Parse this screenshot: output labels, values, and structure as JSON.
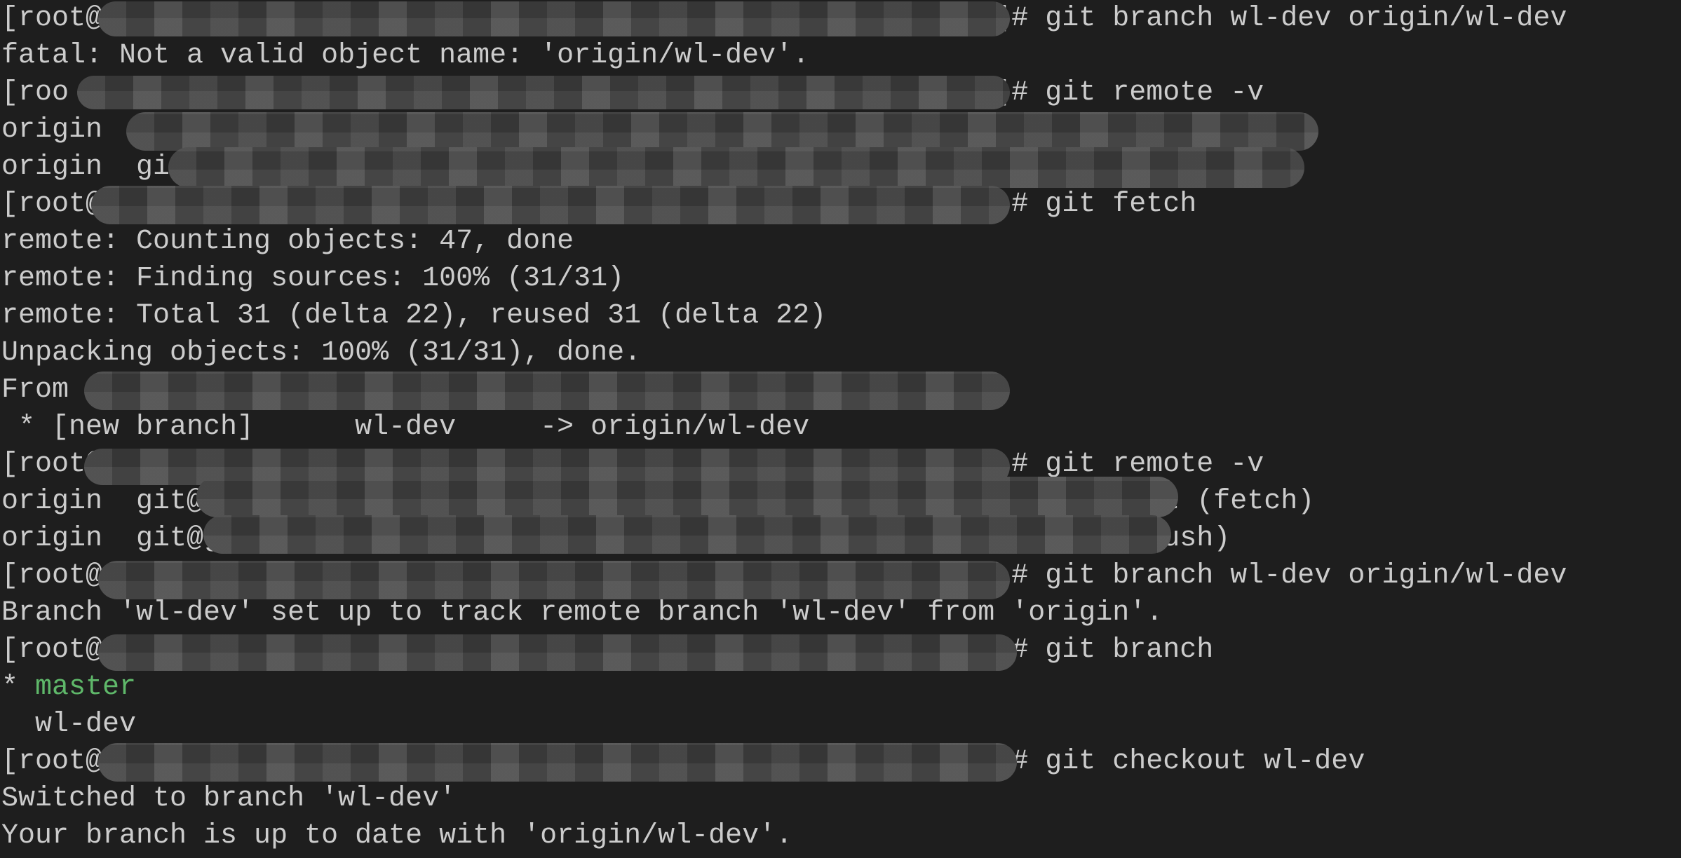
{
  "terminal": {
    "colors": {
      "background": "#1e1e1e",
      "text": "#cccccc",
      "branch_current": "#5fb86a"
    },
    "lines": [
      [
        {
          "t": "[root@                                                     ]# git branch wl-dev origin/wl-dev"
        }
      ],
      [
        {
          "t": "fatal: Not a valid object name: 'origin/wl-dev'."
        }
      ],
      [
        {
          "t": "[roo                                                       ]# git remote -v"
        }
      ],
      [
        {
          "t": "origin"
        }
      ],
      [
        {
          "t": "origin  gi"
        }
      ],
      [
        {
          "t": "[root@                                                      # git fetch"
        }
      ],
      [
        {
          "t": "remote: Counting objects: 47, done"
        }
      ],
      [
        {
          "t": "remote: Finding sources: 100% (31/31)"
        }
      ],
      [
        {
          "t": "remote: Total 31 (delta 22), reused 31 (delta 22)"
        }
      ],
      [
        {
          "t": "Unpacking objects: 100% (31/31), done."
        }
      ],
      [
        {
          "t": "From"
        }
      ],
      [
        {
          "t": " * [new branch]      wl-dev     -> origin/wl-dev"
        }
      ],
      [
        {
          "t": "[root@                                                      # git remote -v"
        }
      ],
      [
        {
          "t": "origin  git@                                                        it (fetch)"
        }
      ],
      [
        {
          "t": "origin  git@gi                                                     (push)"
        }
      ],
      [
        {
          "t": "[root@                                                      # git branch wl-dev origin/wl-dev"
        }
      ],
      [
        {
          "t": "Branch 'wl-dev' set up to track remote branch 'wl-dev' from 'origin'."
        }
      ],
      [
        {
          "t": "[root@                                                     ]# git branch"
        }
      ],
      [
        {
          "t": "* "
        },
        {
          "t": "master",
          "c": "green"
        }
      ],
      [
        {
          "t": "  wl-dev"
        }
      ],
      [
        {
          "t": "[root@                                                     ]# git checkout wl-dev"
        }
      ],
      [
        {
          "t": "Switched to branch 'wl-dev'"
        }
      ],
      [
        {
          "t": "Your branch is up to date with 'origin/wl-dev'."
        }
      ]
    ]
  }
}
